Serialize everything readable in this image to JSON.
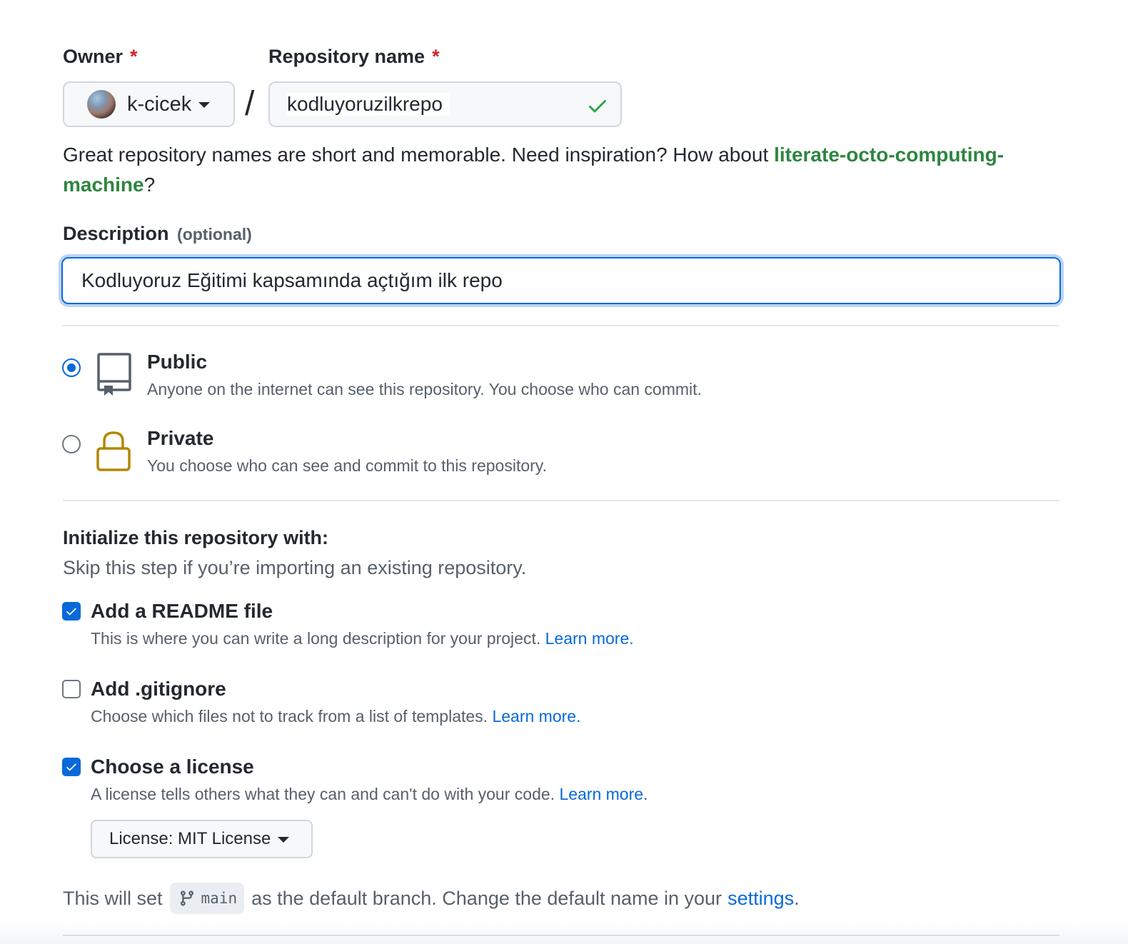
{
  "owner": {
    "label": "Owner",
    "required_mark": "*",
    "value": "k-cicek"
  },
  "repo_name": {
    "label": "Repository name",
    "required_mark": "*",
    "value": "kodluyoruzilkrepo",
    "valid_icon": "check-icon"
  },
  "separator": "/",
  "hint": {
    "text": "Great repository names are short and memorable. Need inspiration? How about ",
    "suggestion": "literate-octo-computing-machine",
    "suffix": "?"
  },
  "description": {
    "label": "Description",
    "optional": "(optional)",
    "value": "Kodluyoruz Eğitimi kapsamında açtığım ilk repo"
  },
  "visibility": {
    "selected": "public",
    "public": {
      "title": "Public",
      "desc": "Anyone on the internet can see this repository. You choose who can commit.",
      "icon": "repo-icon"
    },
    "private": {
      "title": "Private",
      "desc": "You choose who can see and commit to this repository.",
      "icon": "lock-icon"
    }
  },
  "initialize": {
    "title": "Initialize this repository with:",
    "subtitle": "Skip this step if you’re importing an existing repository.",
    "readme": {
      "checked": true,
      "title": "Add a README file",
      "desc": "This is where you can write a long description for your project.",
      "link": "Learn more."
    },
    "gitignore": {
      "checked": false,
      "title": "Add .gitignore",
      "desc": "Choose which files not to track from a list of templates.",
      "link": "Learn more."
    },
    "license": {
      "checked": true,
      "title": "Choose a license",
      "desc": "A license tells others what they can and can't do with your code.",
      "link": "Learn more.",
      "select_label": "License: MIT License"
    }
  },
  "default_branch": {
    "prefix": "This will set",
    "branch": "main",
    "middle": "as the default branch. Change the default name in your",
    "link": "settings",
    "suffix": "."
  },
  "colors": {
    "accent": "#0969da",
    "required": "#cf222e",
    "suggestion": "#2e8540",
    "valid": "#2da44e",
    "lock": "#b08800"
  }
}
